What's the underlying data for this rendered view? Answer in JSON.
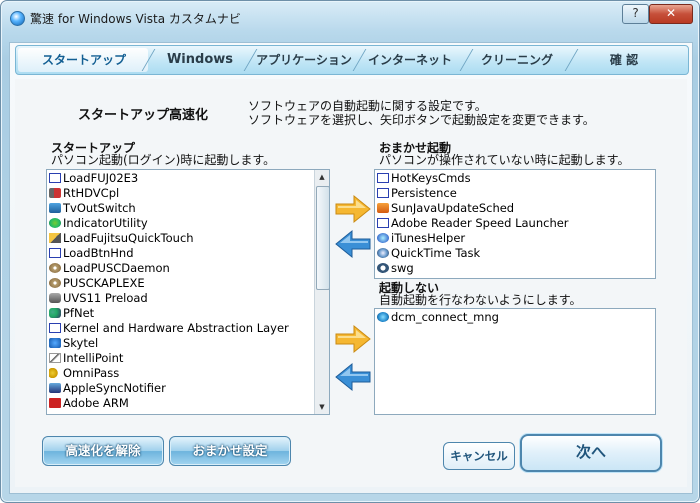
{
  "window": {
    "title": "驚速 for Windows Vista カスタムナビ",
    "help_label": "?",
    "close_label": "✕"
  },
  "tabs": [
    "スタートアップ",
    "Windows",
    "アプリケーション",
    "インターネット",
    "クリーニング",
    "確 認"
  ],
  "active_tab": 0,
  "page": {
    "heading": "スタートアップ高速化",
    "desc_line1": "ソフトウェアの自動起動に関する設定です。",
    "desc_line2": "ソフトウェアを選択し、矢印ボタンで起動設定を変更できます。"
  },
  "startup": {
    "title": "スタートアップ",
    "subtitle": "パソコン起動(ログイン)時に起動します。",
    "items": [
      {
        "label": "LoadFUJ02E3",
        "icon": "window-icon"
      },
      {
        "label": "RtHDVCpl",
        "icon": "speaker-icon"
      },
      {
        "label": "TvOutSwitch",
        "icon": "tv-icon"
      },
      {
        "label": "IndicatorUtility",
        "icon": "gear-icon"
      },
      {
        "label": "LoadFujitsuQuickTouch",
        "icon": "pen-icon"
      },
      {
        "label": "LoadBtnHnd",
        "icon": "window-icon"
      },
      {
        "label": "LoadPUSCDaemon",
        "icon": "cd-icon"
      },
      {
        "label": "PUSCKAPLEXE",
        "icon": "cd-icon"
      },
      {
        "label": "UVS11 Preload",
        "icon": "car-icon"
      },
      {
        "label": "PfNet",
        "icon": "people-icon"
      },
      {
        "label": "Kernel and Hardware Abstraction Layer",
        "icon": "window-icon"
      },
      {
        "label": "Skytel",
        "icon": "bluegear-icon"
      },
      {
        "label": "IntelliPoint",
        "icon": "cursor-icon"
      },
      {
        "label": "OmniPass",
        "icon": "key-icon"
      },
      {
        "label": "AppleSyncNotifier",
        "icon": "apple-icon"
      },
      {
        "label": "Adobe ARM",
        "icon": "pdf-icon"
      }
    ]
  },
  "omakase": {
    "title": "おまかせ起動",
    "subtitle": "パソコンが操作されていない時に起動します。",
    "items": [
      {
        "label": "HotKeysCmds",
        "icon": "window-icon"
      },
      {
        "label": "Persistence",
        "icon": "window-icon"
      },
      {
        "label": "SunJavaUpdateSched",
        "icon": "java-icon"
      },
      {
        "label": "Adobe Reader Speed Launcher",
        "icon": "window-icon"
      },
      {
        "label": "iTunesHelper",
        "icon": "itunes-icon"
      },
      {
        "label": "QuickTime Task",
        "icon": "quicktime-icon"
      },
      {
        "label": "swg",
        "icon": "swg-icon"
      }
    ]
  },
  "disabled": {
    "title": "起動しない",
    "subtitle": "自動起動を行なわないようにします。",
    "items": [
      {
        "label": "dcm_connect_mng",
        "icon": "dcm-icon"
      }
    ]
  },
  "buttons": {
    "release": "高速化を解除",
    "omakase_setting": "おまかせ設定",
    "cancel": "キャンセル",
    "next": "次へ"
  },
  "colors": {
    "accent": "#6db4dd",
    "arrow_yellow": "#f5b731",
    "arrow_blue": "#3a8fd6"
  }
}
